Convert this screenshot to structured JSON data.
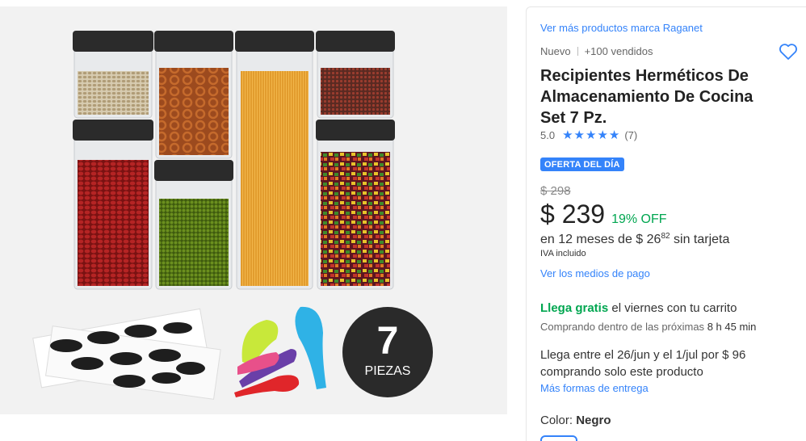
{
  "gallery": {
    "badge_number": "7",
    "badge_word": "PIEZAS",
    "colors": {
      "lid": "#2b2b2b",
      "badge": "#2a2a2a",
      "bg": "#f2f2f2"
    }
  },
  "product": {
    "brand_link": "Ver más productos marca Raganet",
    "condition": "Nuevo",
    "sold": "+100 vendidos",
    "title": "Recipientes Herméticos De Almacenamiento De Cocina Set 7 Pz.",
    "rating": "5.0",
    "stars": 5,
    "reviews": "(7)",
    "deal_badge": "OFERTA DEL DÍA",
    "old_price": "$ 298",
    "price": "$ 239",
    "discount": "19% OFF",
    "installments_prefix": "en 12 meses de $ 26",
    "installments_cents": "82",
    "installments_suffix": "sin tarjeta",
    "tax_note": "IVA incluido",
    "payment_link": "Ver los medios de pago"
  },
  "shipping": {
    "free_label": "Llega gratis",
    "free_rest": "el viernes con tu carrito",
    "countdown_prefix": "Comprando dentro de las próximas",
    "countdown_value": "8 h 45 min",
    "alt_delivery": "Llega entre el 26/jun y el 1/jul por $ 96 comprando solo este producto",
    "more_link": "Más formas de entrega"
  },
  "variant": {
    "color_label": "Color:",
    "color_value": "Negro"
  },
  "accent_colors": {
    "link": "#3483fa",
    "green": "#00a650"
  }
}
